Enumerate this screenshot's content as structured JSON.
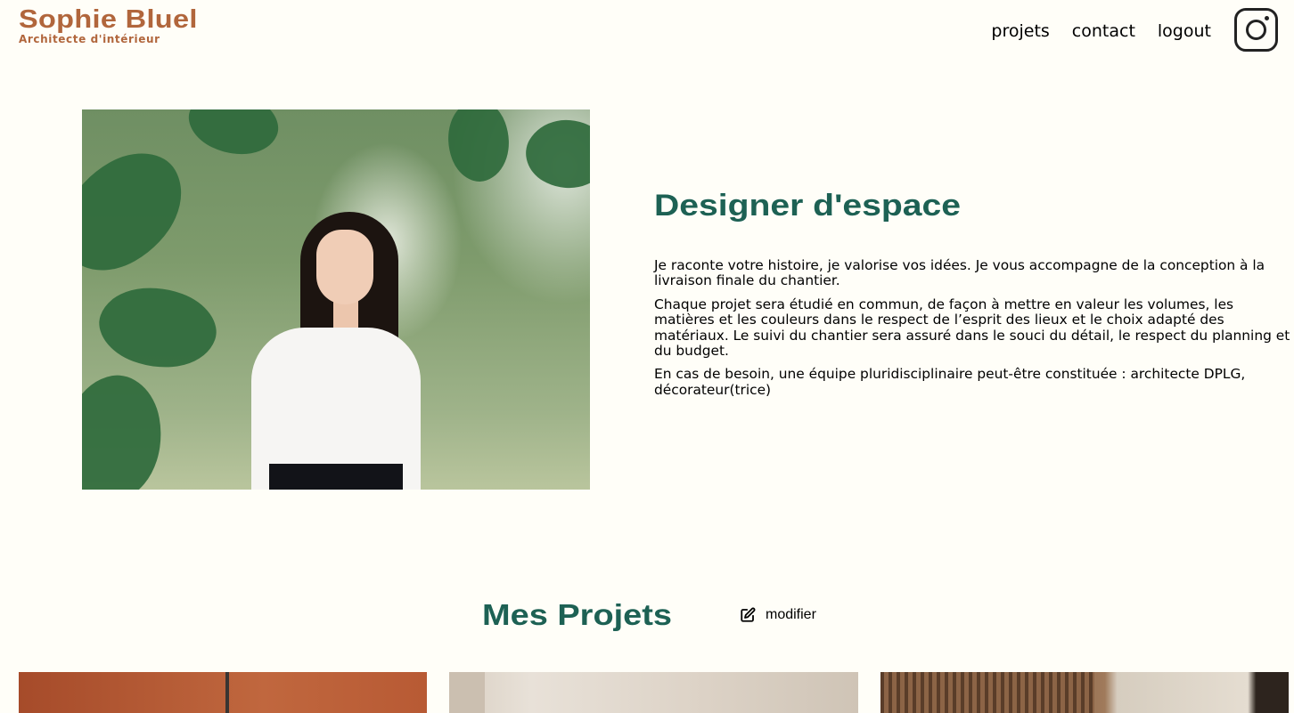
{
  "header": {
    "logo_title": "Sophie Bluel",
    "logo_subtitle": "Architecte d'intérieur",
    "nav": [
      {
        "label": "projets"
      },
      {
        "label": "contact"
      },
      {
        "label": "logout"
      }
    ],
    "social_icon": "instagram-icon"
  },
  "about": {
    "title": "Designer d'espace",
    "paragraphs": [
      "Je raconte votre histoire, je valorise vos idées. Je vous accompagne de la conception à la livraison finale du chantier.",
      "Chaque projet sera étudié en commun, de façon à mettre en valeur les volumes, les matières et les couleurs dans le respect de l’esprit des lieux et le choix adapté des matériaux. Le suivi du chantier sera assuré dans le souci du détail, le respect du planning et du budget.",
      "En cas de besoin, une équipe pluridisciplinaire peut-être constituée : architecte DPLG, décorateur(trice)"
    ]
  },
  "portfolio": {
    "title": "Mes Projets",
    "edit_label": "modifier",
    "edit_icon": "edit-icon"
  },
  "colors": {
    "brand": "#b1663c",
    "accent": "#1d6154",
    "background": "#fffef8"
  }
}
